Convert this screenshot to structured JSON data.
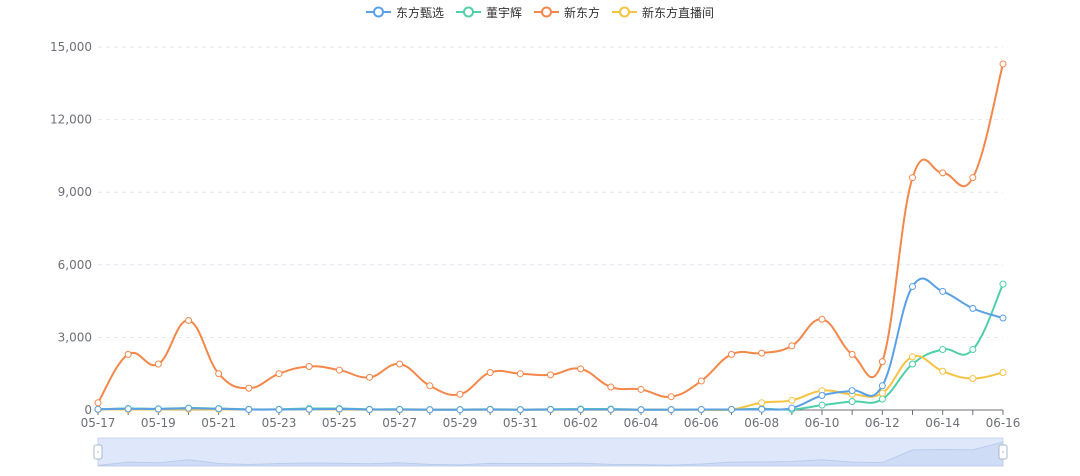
{
  "chart_data": {
    "type": "line",
    "title": "",
    "xlabel": "",
    "ylabel": "",
    "smooth": true,
    "grid": "horizontal dashed",
    "legend_position": "top-center",
    "ylim": [
      0,
      15000
    ],
    "yticks": [
      0,
      3000,
      6000,
      9000,
      12000,
      15000
    ],
    "ytick_labels": [
      "0",
      "3,000",
      "6,000",
      "9,000",
      "12,000",
      "15,000"
    ],
    "x": [
      "05-17",
      "05-18",
      "05-19",
      "05-20",
      "05-21",
      "05-22",
      "05-23",
      "05-24",
      "05-25",
      "05-26",
      "05-27",
      "05-28",
      "05-29",
      "05-30",
      "05-31",
      "06-01",
      "06-02",
      "06-03",
      "06-04",
      "06-05",
      "06-06",
      "06-07",
      "06-08",
      "06-09",
      "06-10",
      "06-11",
      "06-12",
      "06-13",
      "06-14",
      "06-15",
      "06-16"
    ],
    "xtick_labels": [
      "05-17",
      "05-19",
      "05-21",
      "05-23",
      "05-25",
      "05-27",
      "05-29",
      "05-31",
      "06-02",
      "06-04",
      "06-06",
      "06-08",
      "06-10",
      "06-12",
      "06-14",
      "06-16"
    ],
    "series": [
      {
        "name": "东方甄选",
        "color": "#5aa0e6",
        "values": [
          30,
          50,
          40,
          70,
          50,
          20,
          20,
          30,
          40,
          20,
          20,
          10,
          10,
          20,
          10,
          20,
          20,
          20,
          10,
          10,
          20,
          20,
          30,
          80,
          600,
          800,
          1000,
          5100,
          4900,
          4200,
          3800
        ]
      },
      {
        "name": "董宇辉",
        "color": "#4fcfa8",
        "values": [
          30,
          60,
          50,
          80,
          60,
          30,
          30,
          60,
          60,
          30,
          30,
          20,
          20,
          30,
          20,
          30,
          40,
          40,
          20,
          20,
          20,
          20,
          50,
          20,
          200,
          350,
          450,
          1900,
          2500,
          2500,
          5200
        ]
      },
      {
        "name": "新东方",
        "color": "#f4874a",
        "values": [
          300,
          2300,
          1900,
          3700,
          1500,
          900,
          1500,
          1800,
          1650,
          1350,
          1900,
          1000,
          650,
          1550,
          1500,
          1450,
          1700,
          950,
          850,
          550,
          1200,
          2300,
          2350,
          2650,
          3750,
          2300,
          2000,
          9600,
          9800,
          9600,
          14300
        ]
      },
      {
        "name": "新东方直播间",
        "color": "#f6c342",
        "values": [
          20,
          20,
          20,
          30,
          20,
          20,
          20,
          20,
          20,
          10,
          10,
          10,
          10,
          10,
          10,
          10,
          10,
          10,
          10,
          10,
          10,
          20,
          300,
          400,
          800,
          650,
          700,
          2200,
          1600,
          1300,
          1550
        ]
      }
    ]
  },
  "legend": {
    "items": [
      {
        "label": "东方甄选",
        "color": "#5aa0e6"
      },
      {
        "label": "董宇辉",
        "color": "#4fcfa8"
      },
      {
        "label": "新东方",
        "color": "#f4874a"
      },
      {
        "label": "新东方直播间",
        "color": "#f6c342"
      }
    ]
  }
}
